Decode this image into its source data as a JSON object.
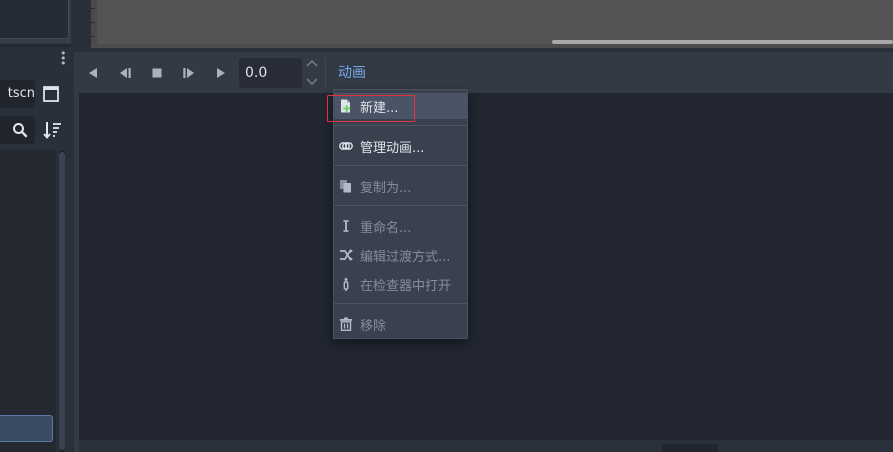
{
  "left_dock": {
    "scene_tab_partial": "tscn"
  },
  "animation_panel": {
    "time_value": "0.0",
    "animation_menu_label": "动画"
  },
  "animation_menu": {
    "items": [
      {
        "label": "新建...",
        "icon": "new-file-icon",
        "enabled": true
      },
      {
        "label": "管理动画...",
        "icon": "animation-library-icon",
        "enabled": true
      },
      {
        "label": "复制为...",
        "icon": "duplicate-icon",
        "enabled": false
      },
      {
        "label": "重命名...",
        "icon": "rename-icon",
        "enabled": false
      },
      {
        "label": "编辑过渡方式...",
        "icon": "blend-transitions-icon",
        "enabled": false
      },
      {
        "label": "在检查器中打开",
        "icon": "inspector-icon",
        "enabled": false
      },
      {
        "label": "移除",
        "icon": "remove-icon",
        "enabled": false
      }
    ]
  },
  "colors": {
    "accent": "#78a9e8",
    "highlight": "#e0333b",
    "menu_bg": "#3a414e",
    "panel_bg": "#212631"
  }
}
